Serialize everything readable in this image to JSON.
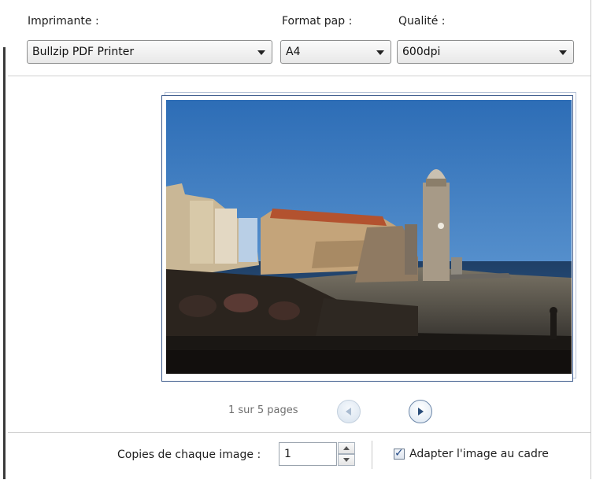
{
  "printer": {
    "label": "Imprimante :",
    "value": "Bullzip PDF Printer"
  },
  "paper_format": {
    "label": "Format pap :",
    "value": "A4"
  },
  "quality": {
    "label": "Qualité :",
    "value": "600dpi"
  },
  "preview": {
    "image_description": "Photo: Collioure harbor with church bell tower, sea and crowded waterfront terrace",
    "pager_text": "1 sur 5 pages",
    "prev_icon": "chevron-left-icon",
    "next_icon": "chevron-right-icon"
  },
  "copies": {
    "label": "Copies de chaque image :",
    "value": "1"
  },
  "fit_image": {
    "label": "Adapter l'image au cadre",
    "checked": true
  }
}
